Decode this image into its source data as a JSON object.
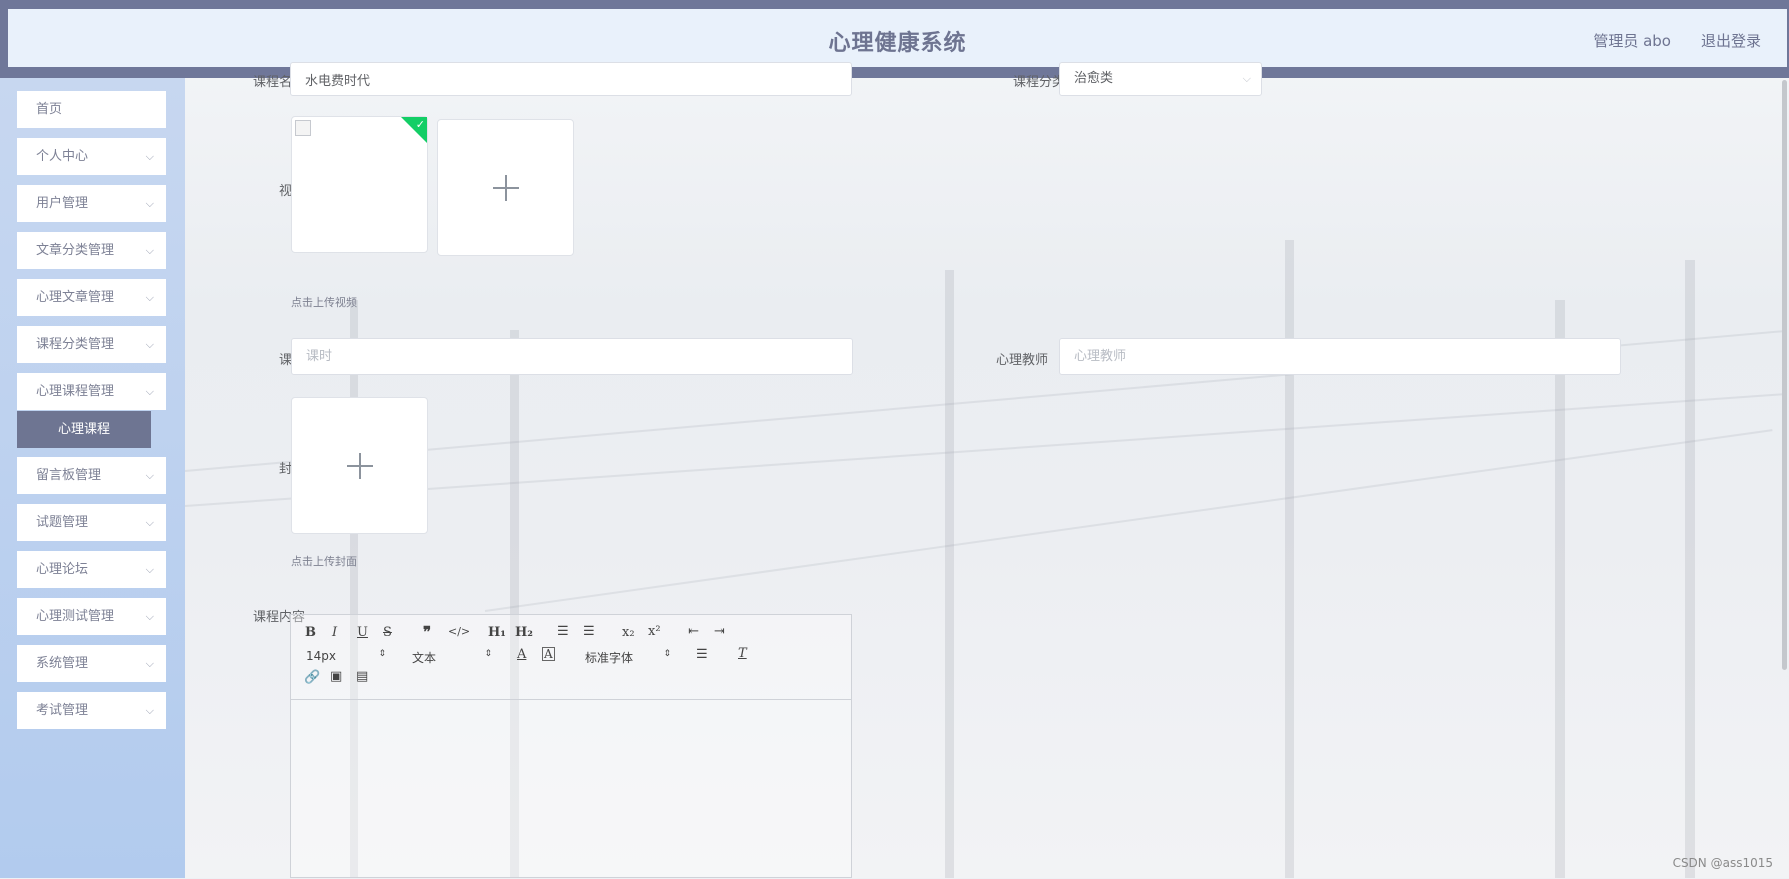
{
  "header": {
    "title": "心理健康系统",
    "user": "管理员 abo",
    "logout": "退出登录"
  },
  "sidebar": {
    "items": [
      {
        "label": "首页",
        "has_arrow": false
      },
      {
        "label": "个人中心",
        "has_arrow": true
      },
      {
        "label": "用户管理",
        "has_arrow": true
      },
      {
        "label": "文章分类管理",
        "has_arrow": true
      },
      {
        "label": "心理文章管理",
        "has_arrow": true
      },
      {
        "label": "课程分类管理",
        "has_arrow": true
      },
      {
        "label": "心理课程管理",
        "has_arrow": true
      },
      {
        "label": "留言板管理",
        "has_arrow": true
      },
      {
        "label": "试题管理",
        "has_arrow": true
      },
      {
        "label": "心理论坛",
        "has_arrow": true
      },
      {
        "label": "心理测试管理",
        "has_arrow": true
      },
      {
        "label": "系统管理",
        "has_arrow": true
      },
      {
        "label": "考试管理",
        "has_arrow": true
      }
    ],
    "active_submenu": "心理课程"
  },
  "form": {
    "course_name": {
      "label": "课程名称",
      "value": "水电费时代"
    },
    "course_category": {
      "label": "课程分类",
      "value": "治愈类"
    },
    "video": {
      "label": "视频",
      "hint": "点击上传视频"
    },
    "hours": {
      "label": "课时",
      "placeholder": "课时",
      "value": ""
    },
    "teacher": {
      "label": "心理教师",
      "placeholder": "心理教师",
      "value": ""
    },
    "cover": {
      "label": "封面",
      "hint": "点击上传封面"
    },
    "content": {
      "label": "课程内容"
    }
  },
  "editor": {
    "font_size": "14px",
    "header_select": "文本",
    "font_family": "标准字体"
  },
  "watermark": "CSDN @ass1015"
}
